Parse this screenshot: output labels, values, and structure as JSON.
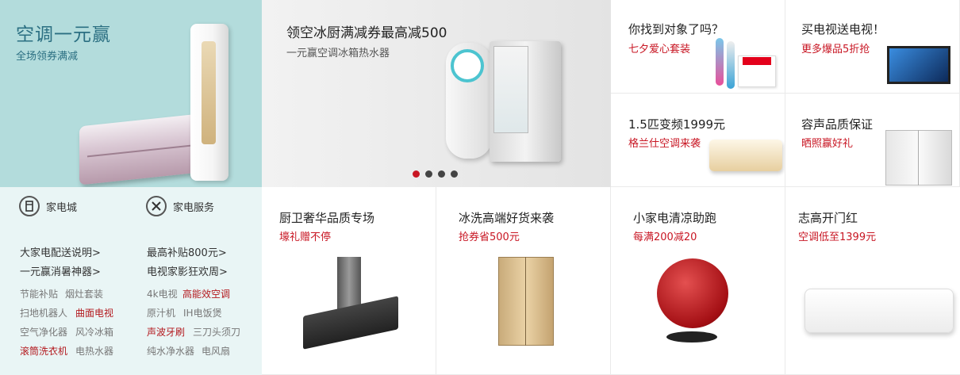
{
  "left": {
    "promo_title": "空调一元赢",
    "promo_sub": "全场领券满减",
    "nav": [
      {
        "label": "家电城",
        "icon": "fridge-icon"
      },
      {
        "label": "家电服务",
        "icon": "tools-icon"
      }
    ],
    "links": [
      "大家电配送说明>",
      "最高补贴800元>",
      "一元赢消暑神器>",
      "电视家影狂欢周>"
    ],
    "tags": [
      {
        "text": "节能补贴",
        "red": false
      },
      {
        "text": "烟灶套装",
        "red": false
      },
      {
        "text": "4k电视",
        "red": false
      },
      {
        "text": "高能效空调",
        "red": true
      },
      {
        "text": "扫地机器人",
        "red": false
      },
      {
        "text": "曲面电视",
        "red": true
      },
      {
        "text": "原汁机",
        "red": false
      },
      {
        "text": "IH电饭煲",
        "red": false
      },
      {
        "text": "空气净化器",
        "red": false
      },
      {
        "text": "风冷冰箱",
        "red": false
      },
      {
        "text": "声波牙刷",
        "red": true
      },
      {
        "text": "三刀头须刀",
        "red": false
      },
      {
        "text": "滚筒洗衣机",
        "red": true
      },
      {
        "text": "电热水器",
        "red": false
      },
      {
        "text": "纯水净水器",
        "red": false
      },
      {
        "text": "电风扇",
        "red": false
      }
    ]
  },
  "banner": {
    "title": "领空冰厨满减券最高减500",
    "subtitle": "一元赢空调冰箱热水器",
    "dots": 4,
    "active_dot": 0
  },
  "tiles_top": [
    {
      "title": "你找到对象了吗？",
      "sub": "七夕爱心套装"
    },
    {
      "title": "买电视送电视！",
      "sub": "更多爆品5折抢"
    },
    {
      "title": "1.5匹变频1999元",
      "sub": "格兰仕空调来袭"
    },
    {
      "title": "容声品质保证",
      "sub": "晒照赢好礼"
    }
  ],
  "tiles_bottom": [
    {
      "title": "厨卫奢华品质专场",
      "sub": "壕礼赠不停"
    },
    {
      "title": "冰洗高端好货来袭",
      "sub": "抢券省500元"
    },
    {
      "title": "小家电清凉助跑",
      "sub": "每满200减20"
    },
    {
      "title": "志高开门红",
      "sub": "空调低至1399元"
    }
  ],
  "colors": {
    "accent_red": "#c81623",
    "promo_bg": "#b3dcdc",
    "promo_text": "#2b6f82",
    "menu_bg": "#e9f5f5"
  }
}
